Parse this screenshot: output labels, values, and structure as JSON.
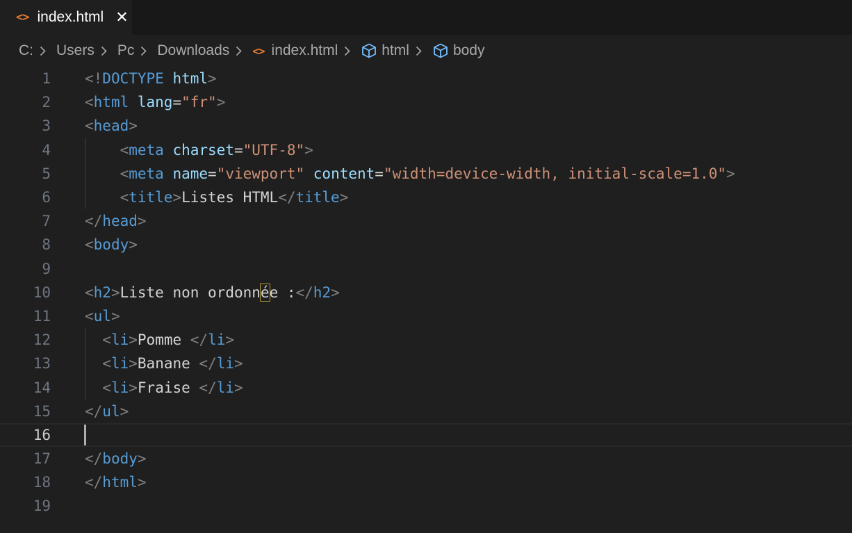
{
  "tab": {
    "label": "index.html",
    "icon": "html-file-icon",
    "close": "✕"
  },
  "breadcrumb": {
    "parts": [
      "C:",
      "Users",
      "Pc",
      "Downloads",
      "index.html",
      "html",
      "body"
    ]
  },
  "colors": {
    "background": "#1f1f1f",
    "tag": "#569cd6",
    "attribute": "#9cdcfe",
    "string": "#ce9178",
    "punctuation": "#808080",
    "file_icon": "#e37933"
  },
  "editor": {
    "active_line": 16,
    "lines": [
      {
        "n": "1",
        "tokens": [
          [
            "p",
            "<!"
          ],
          [
            "t",
            "DOCTYPE "
          ],
          [
            "a",
            "html"
          ],
          [
            "p",
            ">"
          ]
        ]
      },
      {
        "n": "2",
        "tokens": [
          [
            "p",
            "<"
          ],
          [
            "t",
            "html "
          ],
          [
            "a",
            "lang"
          ],
          [
            "x",
            "="
          ],
          [
            "s",
            "\"fr\""
          ],
          [
            "p",
            ">"
          ]
        ]
      },
      {
        "n": "3",
        "tokens": [
          [
            "p",
            "<"
          ],
          [
            "t",
            "head"
          ],
          [
            "p",
            ">"
          ]
        ]
      },
      {
        "n": "4",
        "tokens": [
          [
            "x",
            "    "
          ],
          [
            "p",
            "<"
          ],
          [
            "t",
            "meta "
          ],
          [
            "a",
            "charset"
          ],
          [
            "x",
            "="
          ],
          [
            "s",
            "\"UTF-8\""
          ],
          [
            "p",
            ">"
          ]
        ]
      },
      {
        "n": "5",
        "tokens": [
          [
            "x",
            "    "
          ],
          [
            "p",
            "<"
          ],
          [
            "t",
            "meta "
          ],
          [
            "a",
            "name"
          ],
          [
            "x",
            "="
          ],
          [
            "s",
            "\"viewport\""
          ],
          [
            "x",
            " "
          ],
          [
            "a",
            "content"
          ],
          [
            "x",
            "="
          ],
          [
            "s",
            "\"width=device-width, initial-scale=1.0\""
          ],
          [
            "p",
            ">"
          ]
        ]
      },
      {
        "n": "6",
        "tokens": [
          [
            "x",
            "    "
          ],
          [
            "p",
            "<"
          ],
          [
            "t",
            "title"
          ],
          [
            "p",
            ">"
          ],
          [
            "x",
            "Listes HTML"
          ],
          [
            "p",
            "</"
          ],
          [
            "t",
            "title"
          ],
          [
            "p",
            ">"
          ]
        ]
      },
      {
        "n": "7",
        "tokens": [
          [
            "p",
            "</"
          ],
          [
            "t",
            "head"
          ],
          [
            "p",
            ">"
          ]
        ]
      },
      {
        "n": "8",
        "tokens": [
          [
            "p",
            "<"
          ],
          [
            "t",
            "body"
          ],
          [
            "p",
            ">"
          ]
        ]
      },
      {
        "n": "9",
        "tokens": []
      },
      {
        "n": "10",
        "tokens": [
          [
            "p",
            "<"
          ],
          [
            "t",
            "h2"
          ],
          [
            "p",
            ">"
          ],
          [
            "x",
            "Liste non ordonn"
          ],
          [
            "h",
            "é"
          ],
          [
            "x",
            "e :"
          ],
          [
            "p",
            "</"
          ],
          [
            "t",
            "h2"
          ],
          [
            "p",
            ">"
          ]
        ]
      },
      {
        "n": "11",
        "tokens": [
          [
            "p",
            "<"
          ],
          [
            "t",
            "ul"
          ],
          [
            "p",
            ">"
          ]
        ]
      },
      {
        "n": "12",
        "tokens": [
          [
            "x",
            "  "
          ],
          [
            "p",
            "<"
          ],
          [
            "t",
            "li"
          ],
          [
            "p",
            ">"
          ],
          [
            "x",
            "Pomme "
          ],
          [
            "p",
            "</"
          ],
          [
            "t",
            "li"
          ],
          [
            "p",
            ">"
          ]
        ]
      },
      {
        "n": "13",
        "tokens": [
          [
            "x",
            "  "
          ],
          [
            "p",
            "<"
          ],
          [
            "t",
            "li"
          ],
          [
            "p",
            ">"
          ],
          [
            "x",
            "Banane "
          ],
          [
            "p",
            "</"
          ],
          [
            "t",
            "li"
          ],
          [
            "p",
            ">"
          ]
        ]
      },
      {
        "n": "14",
        "tokens": [
          [
            "x",
            "  "
          ],
          [
            "p",
            "<"
          ],
          [
            "t",
            "li"
          ],
          [
            "p",
            ">"
          ],
          [
            "x",
            "Fraise "
          ],
          [
            "p",
            "</"
          ],
          [
            "t",
            "li"
          ],
          [
            "p",
            ">"
          ]
        ]
      },
      {
        "n": "15",
        "tokens": [
          [
            "p",
            "</"
          ],
          [
            "t",
            "ul"
          ],
          [
            "p",
            ">"
          ]
        ]
      },
      {
        "n": "16",
        "tokens": []
      },
      {
        "n": "17",
        "tokens": [
          [
            "p",
            "</"
          ],
          [
            "t",
            "body"
          ],
          [
            "p",
            ">"
          ]
        ]
      },
      {
        "n": "18",
        "tokens": [
          [
            "p",
            "</"
          ],
          [
            "t",
            "html"
          ],
          [
            "p",
            ">"
          ]
        ]
      },
      {
        "n": "19",
        "tokens": []
      }
    ]
  }
}
